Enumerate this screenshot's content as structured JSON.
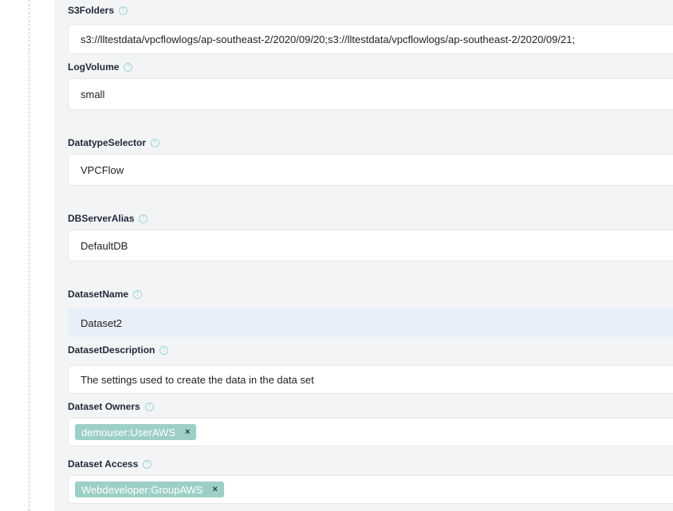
{
  "fields": {
    "s3folders": {
      "label": "S3Folders",
      "value": "s3://lltestdata/vpcflowlogs/ap-southeast-2/2020/09/20;s3://lltestdata/vpcflowlogs/ap-southeast-2/2020/09/21;"
    },
    "logvolume": {
      "label": "LogVolume",
      "value": "small"
    },
    "datatypeselector": {
      "label": "DatatypeSelector",
      "value": "VPCFlow"
    },
    "dbserveralias": {
      "label": "DBServerAlias",
      "value": "DefaultDB"
    },
    "datasetname": {
      "label": "DatasetName",
      "value": "Dataset2"
    },
    "datasetdescription": {
      "label": "DatasetDescription",
      "value": "The settings used to create the data in the data set"
    },
    "datasetowners": {
      "label": "Dataset Owners",
      "tags": [
        "demouser:UserAWS"
      ]
    },
    "datasetaccess": {
      "label": "Dataset Access",
      "tags": [
        "Webdeveloper:GroupAWS"
      ]
    }
  },
  "icons": {
    "info": "info-icon",
    "remove": "close-icon",
    "info_glyph": "!",
    "remove_glyph": "×"
  },
  "colors": {
    "tag_background": "#9ccfc6",
    "highlight_field": "#e8eff9",
    "panel_background": "#f3f4f6",
    "rail_border": "#9fd4cf"
  }
}
